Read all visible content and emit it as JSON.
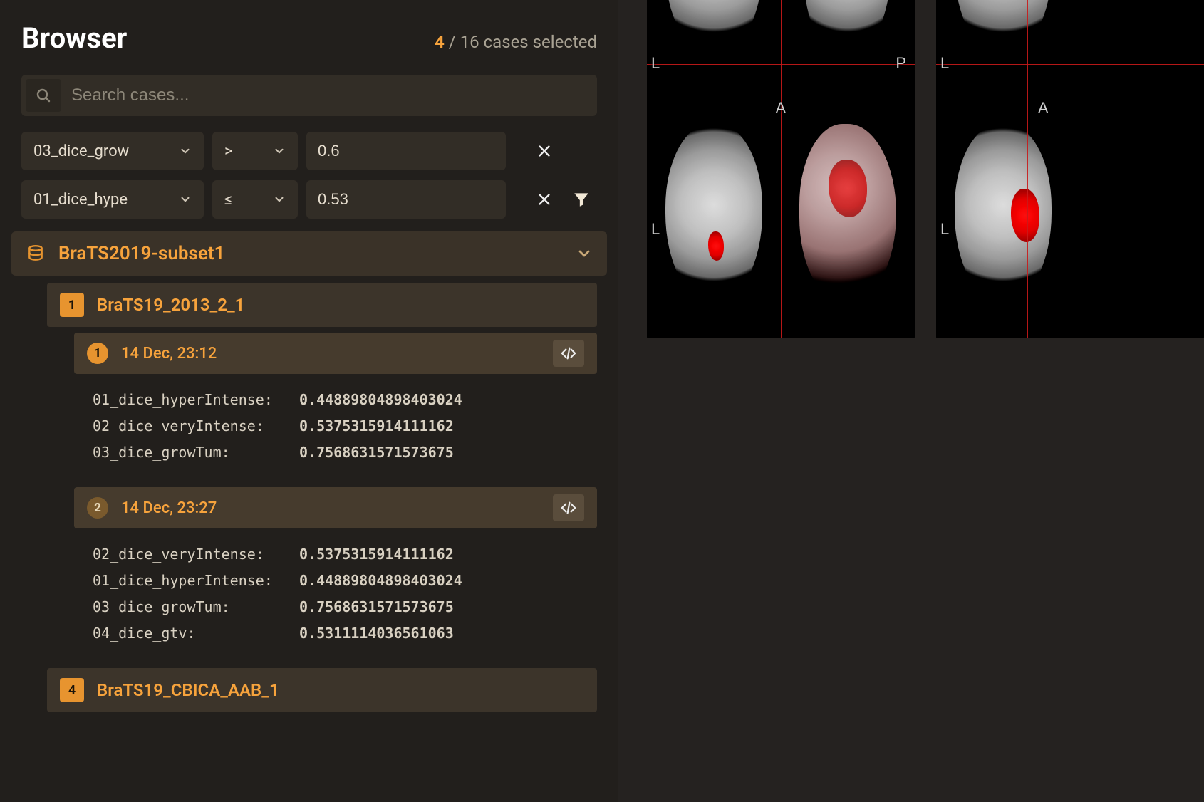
{
  "header": {
    "title": "Browser",
    "selected_count": "4",
    "separator": " / ",
    "total_suffix": "16 cases selected"
  },
  "search": {
    "placeholder": "Search cases..."
  },
  "filters": [
    {
      "field": "03_dice_grow",
      "op": ">",
      "value": "0.6"
    },
    {
      "field": "01_dice_hype",
      "op": "≤",
      "value": "0.53"
    }
  ],
  "dataset": {
    "name": "BraTS2019-subset1",
    "cases": [
      {
        "badge": "1",
        "name": "BraTS19_2013_2_1",
        "passes": [
          {
            "badge": "1",
            "badge_style": "bright",
            "timestamp": "14 Dec, 23:12",
            "metrics": [
              {
                "k": "01_dice_hyperIntense:",
                "v": "0.44889804898403024"
              },
              {
                "k": "02_dice_veryIntense:",
                "v": "0.5375315914111162"
              },
              {
                "k": "03_dice_growTum:",
                "v": "0.7568631571573675"
              }
            ]
          },
          {
            "badge": "2",
            "badge_style": "dim",
            "timestamp": "14 Dec, 23:27",
            "metrics": [
              {
                "k": "02_dice_veryIntense:",
                "v": "0.5375315914111162"
              },
              {
                "k": "01_dice_hyperIntense:",
                "v": "0.44889804898403024"
              },
              {
                "k": "03_dice_growTum:",
                "v": "0.7568631571573675"
              },
              {
                "k": "04_dice_gtv:",
                "v": "0.5311114036561063"
              }
            ]
          }
        ]
      },
      {
        "badge": "4",
        "name": "BraTS19_CBICA_AAB_1",
        "passes": []
      }
    ]
  },
  "viewer": {
    "orientation_labels": {
      "L": "L",
      "P": "P",
      "A": "A"
    }
  }
}
